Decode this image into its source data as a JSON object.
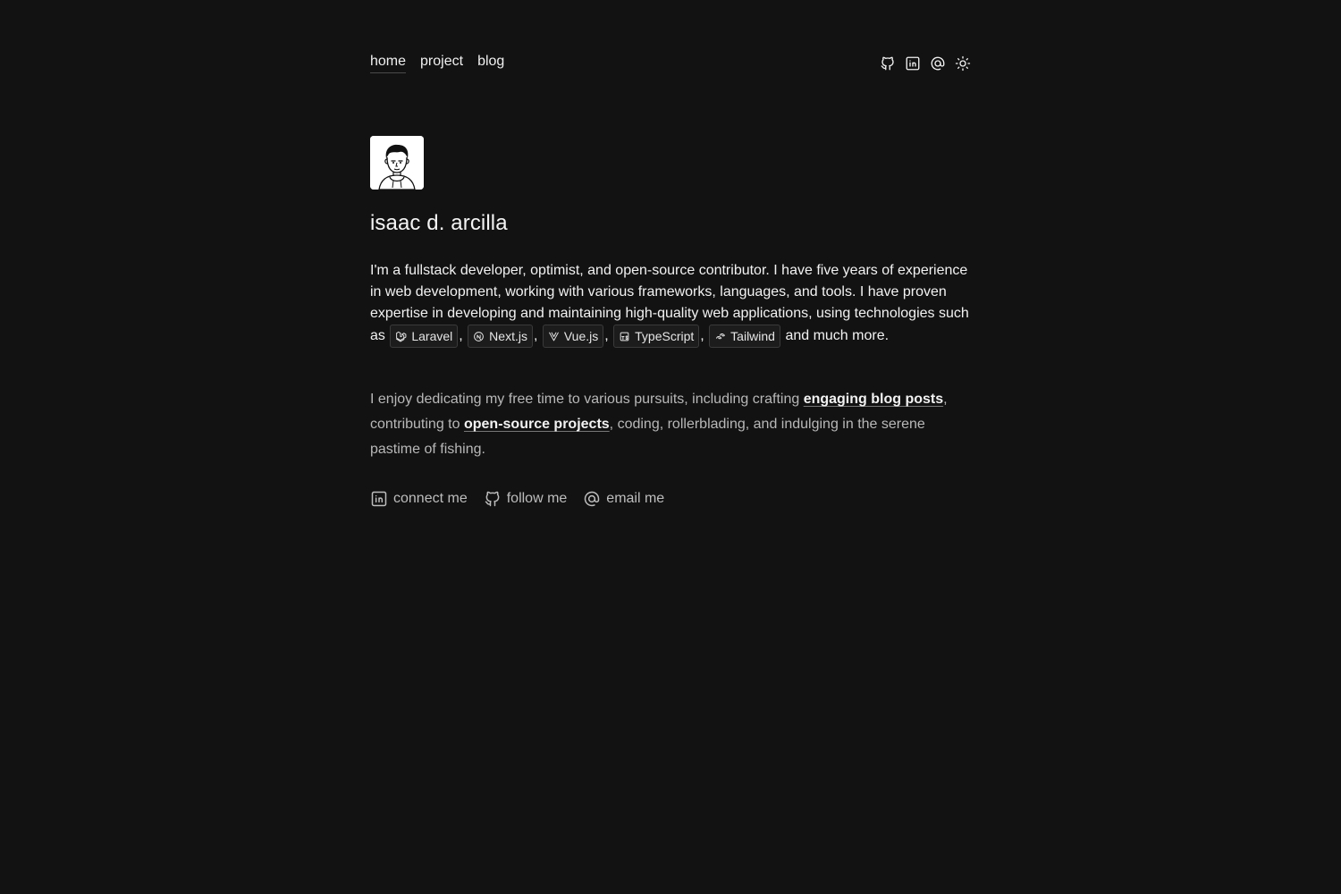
{
  "nav": {
    "links": [
      {
        "label": "home",
        "active": true
      },
      {
        "label": "project",
        "active": false
      },
      {
        "label": "blog",
        "active": false
      }
    ],
    "icons": [
      "github-icon",
      "linkedin-icon",
      "at-sign-icon",
      "sun-icon"
    ]
  },
  "profile": {
    "name": "isaac d. arcilla"
  },
  "bio": {
    "intro": "I'm a fullstack developer, optimist, and open-source contributor. I have five years of experience in web development, working with various frameworks, languages, and tools. I have proven expertise in developing and maintaining high-quality web applications, using technologies such as",
    "technologies": [
      "Laravel",
      "Next.js",
      "Vue.js",
      "TypeScript",
      "Tailwind"
    ],
    "outro": "and much more."
  },
  "hobby": {
    "before": "I enjoy dedicating my free time to various pursuits, including crafting",
    "link1": "engaging blog posts",
    "middle": ", contributing to",
    "link2": "open-source projects",
    "after": ", coding, rollerblading, and indulging in the serene pastime of fishing."
  },
  "social": {
    "linkedin": "connect me",
    "github": "follow me",
    "email": "email me"
  },
  "colors": {
    "background": "#121212",
    "text": "#f2f2f2",
    "muted": "#b8b8b8"
  }
}
